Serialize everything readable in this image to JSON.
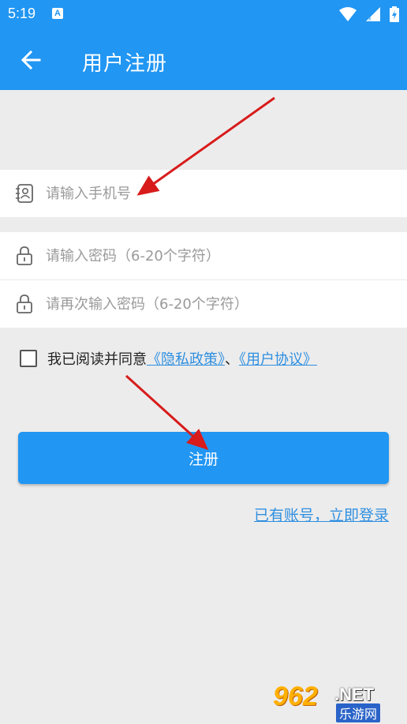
{
  "status_bar": {
    "time": "5:19",
    "notification_letter": "A"
  },
  "app_bar": {
    "title": "用户注册"
  },
  "form": {
    "phone": {
      "value": "",
      "placeholder": "请输入手机号"
    },
    "password": {
      "value": "",
      "placeholder": "请输入密码（6-20个字符）"
    },
    "confirm_password": {
      "value": "",
      "placeholder": "请再次输入密码（6-20个字符）"
    }
  },
  "agreement": {
    "checked": false,
    "prefix": "我已阅读并同意",
    "privacy_link": "《隐私政策》",
    "separator": "、",
    "user_agreement_link": "《用户协议》"
  },
  "register_button": {
    "label": "注册"
  },
  "login_link": {
    "label": "已有账号，立即登录"
  },
  "watermark": {
    "number": "962",
    "suffix": ".NET",
    "site_name": "乐游网"
  },
  "colors": {
    "primary": "#2196f3",
    "link": "#2f8fe0",
    "background": "#ececec",
    "annotation_arrow": "#d81b1b"
  }
}
